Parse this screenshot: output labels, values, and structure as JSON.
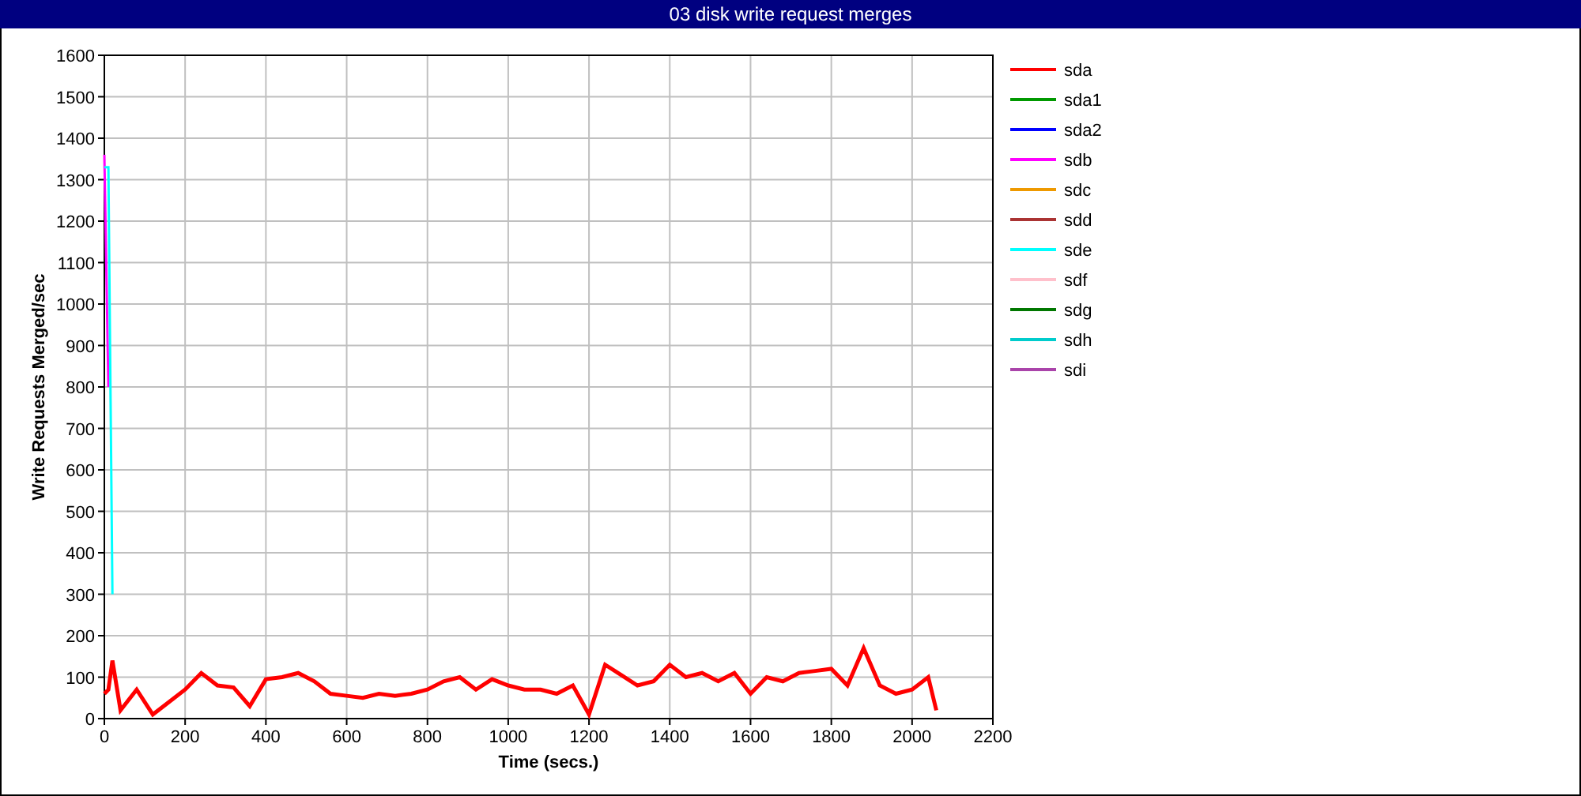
{
  "title": "03 disk write request merges",
  "chart_data": {
    "type": "line",
    "xlabel": "Time (secs.)",
    "ylabel": "Write Requests Merged/sec",
    "xlim": [
      0,
      2200
    ],
    "ylim": [
      0,
      1600
    ],
    "grid": true,
    "legend": "right",
    "xticks": [
      0,
      200,
      400,
      600,
      800,
      1000,
      1200,
      1400,
      1600,
      1800,
      2000,
      2200
    ],
    "yticks": [
      0,
      100,
      200,
      300,
      400,
      500,
      600,
      700,
      800,
      900,
      1000,
      1100,
      1200,
      1300,
      1400,
      1500,
      1600
    ],
    "x": [
      0,
      10,
      20,
      40,
      80,
      120,
      160,
      200,
      240,
      280,
      320,
      360,
      400,
      440,
      480,
      520,
      560,
      600,
      640,
      680,
      720,
      760,
      800,
      840,
      880,
      920,
      960,
      1000,
      1040,
      1080,
      1120,
      1160,
      1200,
      1240,
      1280,
      1320,
      1360,
      1400,
      1440,
      1480,
      1520,
      1560,
      1600,
      1640,
      1680,
      1720,
      1760,
      1800,
      1840,
      1880,
      1920,
      1960,
      2000,
      2040,
      2060
    ],
    "series": [
      {
        "name": "sda",
        "color": "#ff0000",
        "values": [
          60,
          70,
          140,
          20,
          70,
          10,
          40,
          70,
          110,
          80,
          75,
          30,
          95,
          100,
          110,
          90,
          60,
          55,
          50,
          60,
          55,
          60,
          70,
          90,
          100,
          70,
          95,
          80,
          70,
          70,
          60,
          80,
          10,
          130,
          105,
          80,
          90,
          130,
          100,
          110,
          90,
          110,
          60,
          100,
          90,
          110,
          115,
          120,
          80,
          170,
          80,
          60,
          70,
          100,
          20
        ]
      },
      {
        "name": "sda1",
        "color": "#009900",
        "values": [
          null,
          null,
          null,
          null,
          null,
          null,
          null,
          null,
          null,
          null,
          null,
          null,
          null,
          null,
          null,
          null,
          null,
          null,
          null,
          null,
          null,
          null,
          null,
          null,
          null,
          null,
          null,
          null,
          null,
          null,
          null,
          null,
          null,
          null,
          null,
          null,
          null,
          null,
          null,
          null,
          null,
          null,
          null,
          null,
          null,
          null,
          null,
          null,
          null,
          null,
          null,
          null,
          null,
          null,
          null
        ]
      },
      {
        "name": "sda2",
        "color": "#0000ff",
        "values": [
          null,
          null,
          null,
          null,
          null,
          null,
          null,
          null,
          null,
          null,
          null,
          null,
          null,
          null,
          null,
          null,
          null,
          null,
          null,
          null,
          null,
          null,
          null,
          null,
          null,
          null,
          null,
          null,
          null,
          null,
          null,
          null,
          null,
          null,
          null,
          null,
          null,
          null,
          null,
          null,
          null,
          null,
          null,
          null,
          null,
          null,
          null,
          null,
          null,
          null,
          null,
          null,
          null,
          null,
          null
        ]
      },
      {
        "name": "sdb",
        "color": "#ff00ff",
        "values": [
          1360,
          800,
          null,
          null,
          null,
          null,
          null,
          null,
          null,
          null,
          null,
          null,
          null,
          null,
          null,
          null,
          null,
          null,
          null,
          null,
          null,
          null,
          null,
          null,
          null,
          null,
          null,
          null,
          null,
          null,
          null,
          null,
          null,
          null,
          null,
          null,
          null,
          null,
          null,
          null,
          null,
          null,
          null,
          null,
          null,
          null,
          null,
          null,
          null,
          null,
          null,
          null,
          null,
          null,
          null
        ]
      },
      {
        "name": "sdc",
        "color": "#ee9900",
        "values": [
          null,
          null,
          null,
          null,
          null,
          null,
          null,
          null,
          null,
          null,
          null,
          null,
          null,
          null,
          null,
          null,
          null,
          null,
          null,
          null,
          null,
          null,
          null,
          null,
          null,
          null,
          null,
          null,
          null,
          null,
          null,
          null,
          null,
          null,
          null,
          null,
          null,
          null,
          null,
          null,
          null,
          null,
          null,
          null,
          null,
          null,
          null,
          null,
          null,
          null,
          null,
          null,
          null,
          null,
          null
        ]
      },
      {
        "name": "sdd",
        "color": "#aa3333",
        "values": [
          null,
          null,
          null,
          null,
          null,
          null,
          null,
          null,
          null,
          null,
          null,
          null,
          null,
          null,
          null,
          null,
          null,
          null,
          null,
          null,
          null,
          null,
          null,
          null,
          null,
          null,
          null,
          null,
          null,
          null,
          null,
          null,
          null,
          null,
          null,
          null,
          null,
          null,
          null,
          null,
          null,
          null,
          null,
          null,
          null,
          null,
          null,
          null,
          null,
          null,
          null,
          null,
          null,
          null,
          null
        ]
      },
      {
        "name": "sde",
        "color": "#00ffff",
        "values": [
          1330,
          1330,
          300,
          null,
          null,
          null,
          null,
          null,
          null,
          null,
          null,
          null,
          null,
          null,
          null,
          null,
          null,
          null,
          null,
          null,
          null,
          null,
          null,
          null,
          null,
          null,
          null,
          null,
          null,
          null,
          null,
          null,
          null,
          null,
          null,
          null,
          null,
          null,
          null,
          null,
          null,
          null,
          null,
          null,
          null,
          null,
          null,
          null,
          null,
          null,
          null,
          null,
          null,
          null,
          null
        ]
      },
      {
        "name": "sdf",
        "color": "#ffc0cb",
        "values": [
          null,
          null,
          null,
          null,
          null,
          null,
          null,
          null,
          null,
          null,
          null,
          null,
          null,
          null,
          null,
          null,
          null,
          null,
          null,
          null,
          null,
          null,
          null,
          null,
          null,
          null,
          null,
          null,
          null,
          null,
          null,
          null,
          null,
          null,
          null,
          null,
          null,
          null,
          null,
          null,
          null,
          null,
          null,
          null,
          null,
          null,
          null,
          null,
          null,
          null,
          null,
          null,
          null,
          null,
          null
        ]
      },
      {
        "name": "sdg",
        "color": "#007700",
        "values": [
          null,
          null,
          null,
          null,
          null,
          null,
          null,
          null,
          null,
          null,
          null,
          null,
          null,
          null,
          null,
          null,
          null,
          null,
          null,
          null,
          null,
          null,
          null,
          null,
          null,
          null,
          null,
          null,
          null,
          null,
          null,
          null,
          null,
          null,
          null,
          null,
          null,
          null,
          null,
          null,
          null,
          null,
          null,
          null,
          null,
          null,
          null,
          null,
          null,
          null,
          null,
          null,
          null,
          null,
          null
        ]
      },
      {
        "name": "sdh",
        "color": "#00cccc",
        "values": [
          null,
          null,
          null,
          null,
          null,
          null,
          null,
          null,
          null,
          null,
          null,
          null,
          null,
          null,
          null,
          null,
          null,
          null,
          null,
          null,
          null,
          null,
          null,
          null,
          null,
          null,
          null,
          null,
          null,
          null,
          null,
          null,
          null,
          null,
          null,
          null,
          null,
          null,
          null,
          null,
          null,
          null,
          null,
          null,
          null,
          null,
          null,
          null,
          null,
          null,
          null,
          null,
          null,
          null,
          null
        ]
      },
      {
        "name": "sdi",
        "color": "#aa44aa",
        "values": [
          null,
          null,
          null,
          null,
          null,
          null,
          null,
          null,
          null,
          null,
          null,
          null,
          null,
          null,
          null,
          null,
          null,
          null,
          null,
          null,
          null,
          null,
          null,
          null,
          null,
          null,
          null,
          null,
          null,
          null,
          null,
          null,
          null,
          null,
          null,
          null,
          null,
          null,
          null,
          null,
          null,
          null,
          null,
          null,
          null,
          null,
          null,
          null,
          null,
          null,
          null,
          null,
          null,
          null,
          null
        ]
      }
    ]
  }
}
